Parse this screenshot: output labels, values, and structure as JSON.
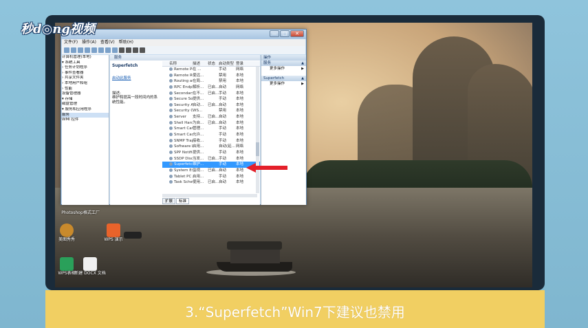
{
  "logo": {
    "text": "秒d◎ng视频"
  },
  "caption": "3.“Superfetch”Win7下建议也禁用",
  "window": {
    "menus": [
      "文件(F)",
      "操作(A)",
      "查看(V)",
      "帮助(H)"
    ],
    "controls": {
      "minimize": "—",
      "maximize": "□",
      "close": "✕"
    },
    "tree": [
      "计算机管理(本地)",
      "▾ 系统工具",
      "  › 任务计划程序",
      "  › 事件查看器",
      "  › 共享文件夹",
      "  › 本地用户和组",
      "  › 性能",
      "    设备管理器",
      "▾ 存储",
      "    磁盘管理",
      "▾ 服务和应用程序",
      "    服务",
      "    WMI 控件"
    ],
    "tree_selected_index": 11,
    "center_header": "服务",
    "detail": {
      "title": "Superfetch",
      "link": "启动此服务",
      "desc_label": "描述:",
      "desc": "维护和提高一段时间内的系统性能。"
    },
    "columns": [
      "名称",
      "描述",
      "状态",
      "启动类型",
      "登录"
    ],
    "rows": [
      [
        "Remote Pro...",
        "在 ...",
        "",
        "手动",
        "网络"
      ],
      [
        "Remote Reg...",
        "使远...",
        "",
        "禁用",
        "本地"
      ],
      [
        "Routing and ...",
        "在局...",
        "",
        "禁用",
        "本地"
      ],
      [
        "RPC Endpoin...",
        "解析...",
        "已启...",
        "自动",
        "网络"
      ],
      [
        "Secondary L...",
        "在不...",
        "已启...",
        "手动",
        "本地"
      ],
      [
        "Secure Sock...",
        "提供...",
        "",
        "手动",
        "本地"
      ],
      [
        "Security Acc...",
        "启动...",
        "已启...",
        "自动",
        "本地"
      ],
      [
        "Security Cen...",
        "WS...",
        "",
        "禁用",
        "本地"
      ],
      [
        "Server",
        "支持...",
        "已启...",
        "自动",
        "本地"
      ],
      [
        "Shell Hardw...",
        "为自...",
        "已启...",
        "自动",
        "本地"
      ],
      [
        "Smart Card",
        "管理...",
        "",
        "手动",
        "本地"
      ],
      [
        "Smart Card ...",
        "允许...",
        "",
        "手动",
        "本地"
      ],
      [
        "SNMP Trap",
        "接收...",
        "",
        "手动",
        "本地"
      ],
      [
        "Software Pro...",
        "启用...",
        "",
        "自动(延...",
        "网络"
      ],
      [
        "SPP Notificat...",
        "提供...",
        "",
        "手动",
        "本地"
      ],
      [
        "SSDP Discov...",
        "当发...",
        "已启...",
        "手动",
        "本地"
      ],
      [
        "Superfetch",
        "维护...",
        "",
        "手动",
        "本地"
      ],
      [
        "System Even...",
        "监视...",
        "已启...",
        "自动",
        "本地"
      ],
      [
        "Tablet PC In...",
        "启用...",
        "",
        "手动",
        "本地"
      ],
      [
        "Task Schedul...",
        "使用...",
        "已启...",
        "自动",
        "本地"
      ]
    ],
    "selected_row_index": 16,
    "tabs": [
      "扩展",
      "标准"
    ],
    "actions": {
      "header": "操作",
      "group1": "服务",
      "group1_more": "更多操作",
      "group2": "Superfetch",
      "group2_more": "更多操作"
    }
  },
  "desktop_icons": [
    {
      "label": "Photoshop",
      "color": "#000000"
    },
    {
      "label": "格式工厂",
      "color": "#000000"
    },
    {
      "label": "美图秀秀",
      "color": "#c98a2c"
    },
    {
      "label": "WPS 演示",
      "color": "#e8632b"
    },
    {
      "label": "WPS表格",
      "color": "#2aa05a"
    },
    {
      "label": "新建 DOCX 文档",
      "color": "#f0f0f0"
    }
  ],
  "colors": {
    "selection": "#3399ff",
    "caption_bar": "#f1cf62",
    "arrow": "#e4202a"
  }
}
